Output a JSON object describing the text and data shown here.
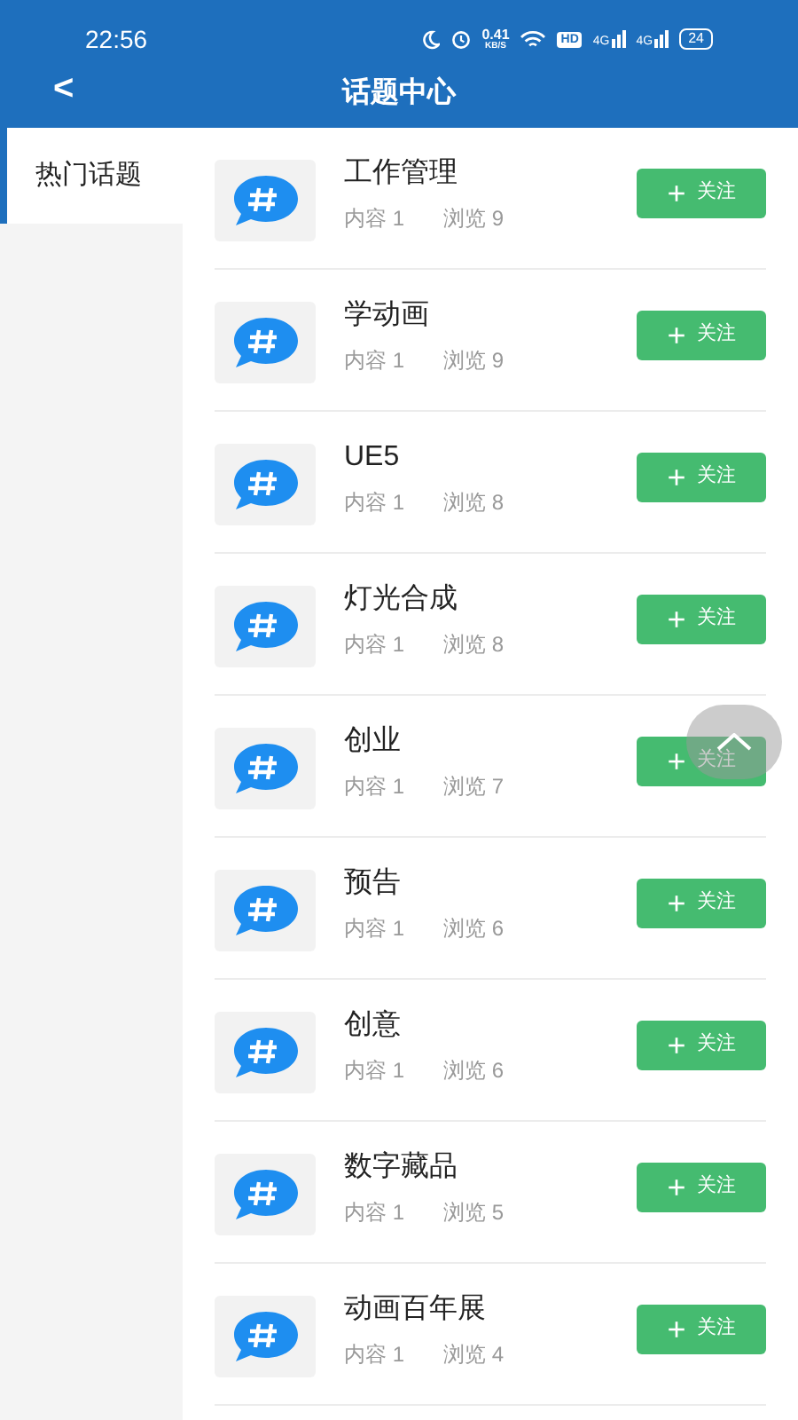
{
  "status_bar": {
    "time": "22:56",
    "speed_value": "0.41",
    "speed_unit": "KB/S",
    "hd": "HD",
    "signal_1": "4G",
    "signal_2": "4G",
    "battery": "24"
  },
  "header": {
    "back": "<",
    "title": "话题中心"
  },
  "sidebar": {
    "items": [
      {
        "label": "热门话题",
        "selected": true
      }
    ]
  },
  "topics": [
    {
      "title": "工作管理",
      "content": "内容 1",
      "views": "浏览 9",
      "plus": "+",
      "follow": "关注"
    },
    {
      "title": "学动画",
      "content": "内容 1",
      "views": "浏览 9",
      "plus": "+",
      "follow": "关注"
    },
    {
      "title": "UE5",
      "content": "内容 1",
      "views": "浏览 8",
      "plus": "+",
      "follow": "关注"
    },
    {
      "title": "灯光合成",
      "content": "内容 1",
      "views": "浏览 8",
      "plus": "+",
      "follow": "关注"
    },
    {
      "title": "创业",
      "content": "内容 1",
      "views": "浏览 7",
      "plus": "+",
      "follow": "关注"
    },
    {
      "title": "预告",
      "content": "内容 1",
      "views": "浏览 6",
      "plus": "+",
      "follow": "关注"
    },
    {
      "title": "创意",
      "content": "内容 1",
      "views": "浏览 6",
      "plus": "+",
      "follow": "关注"
    },
    {
      "title": "数字藏品",
      "content": "内容 1",
      "views": "浏览 5",
      "plus": "+",
      "follow": "关注"
    },
    {
      "title": "动画百年展",
      "content": "内容 1",
      "views": "浏览 4",
      "plus": "+",
      "follow": "关注"
    }
  ]
}
